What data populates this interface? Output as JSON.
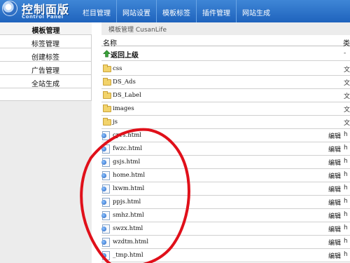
{
  "header": {
    "logo_title": "控制面版",
    "logo_sub": "Control Panel",
    "nav": [
      "栏目管理",
      "网站设置",
      "模板标签",
      "插件管理",
      "网站生成"
    ]
  },
  "sidebar": {
    "title": "模板管理",
    "items": [
      "标签管理",
      "创建标签",
      "广告管理",
      "全站生成"
    ]
  },
  "main": {
    "breadcrumb": "模板管理 CusanLife",
    "header_name": "名称",
    "header_type": "类",
    "up_label": "返回上级",
    "up_type": "-",
    "folders": [
      {
        "name": "css",
        "type": "文"
      },
      {
        "name": "DS_Ads",
        "type": "文"
      },
      {
        "name": "DS_Label",
        "type": "文"
      },
      {
        "name": "images",
        "type": "文"
      },
      {
        "name": "js",
        "type": "文"
      }
    ],
    "edit_label": "编辑",
    "files": [
      {
        "name": "cprs.html",
        "type": "h"
      },
      {
        "name": "fwzc.html",
        "type": "h"
      },
      {
        "name": "gsjs.html",
        "type": "h"
      },
      {
        "name": "home.html",
        "type": "h"
      },
      {
        "name": "lxwm.html",
        "type": "h"
      },
      {
        "name": "ppjs.html",
        "type": "h"
      },
      {
        "name": "smhz.html",
        "type": "h"
      },
      {
        "name": "swzx.html",
        "type": "h"
      },
      {
        "name": "wzdtm.html",
        "type": "h"
      },
      {
        "name": "_tmp.html",
        "type": "h"
      }
    ]
  },
  "annotation": {
    "color": "#e0101a"
  }
}
